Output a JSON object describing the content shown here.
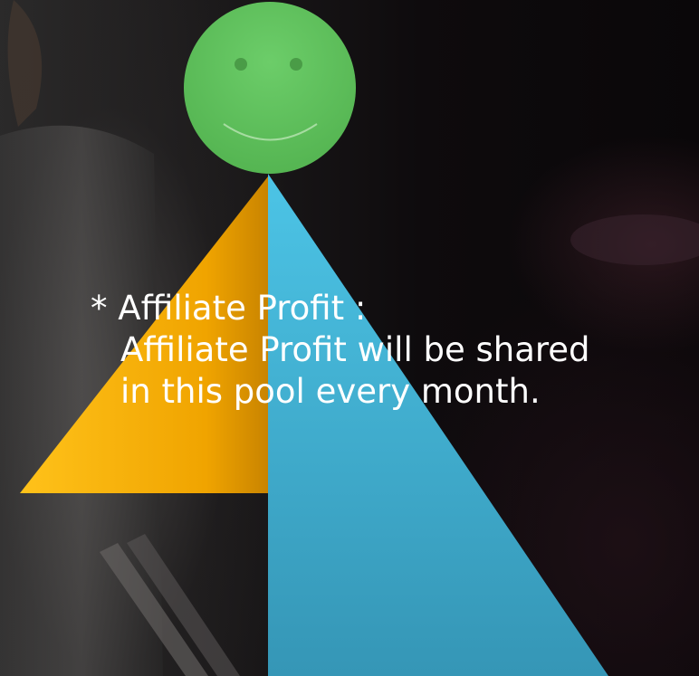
{
  "colors": {
    "smiley": "#5cbf5a",
    "left_triangle": "#f0a400",
    "right_triangle": "#3fafd3"
  },
  "icons": {
    "face": "smiley-face-icon"
  },
  "caption": {
    "heading": "* Affiliate Profit :",
    "line2": "Affiliate Profit will be shared",
    "line3": "in this pool every month."
  }
}
